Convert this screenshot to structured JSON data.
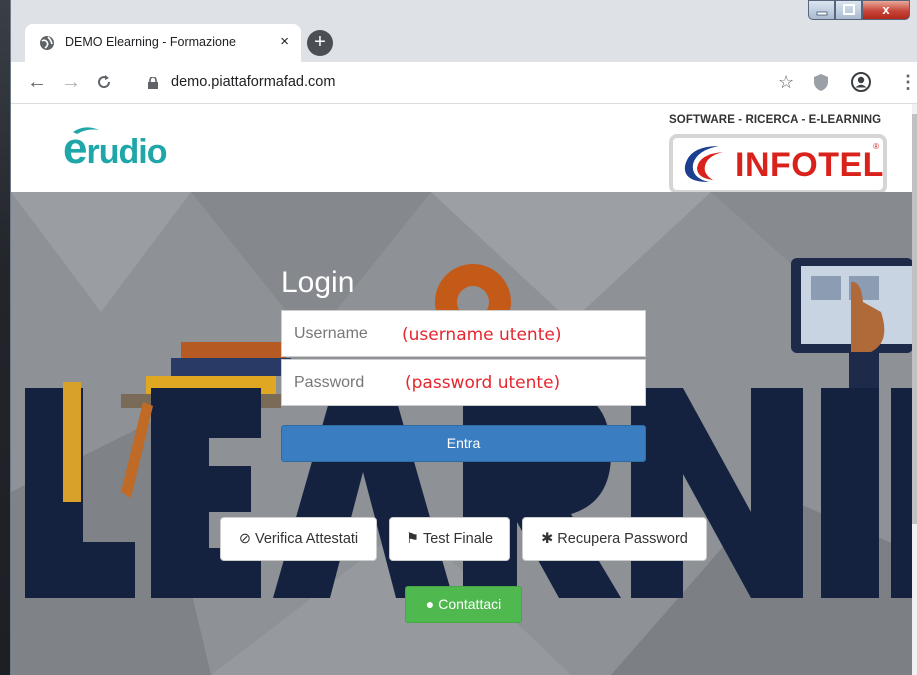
{
  "browser": {
    "tab_title": "DEMO Elearning - Formazione",
    "tab_close": "×",
    "new_tab": "+",
    "url": "demo.piattaformafad.com",
    "window_close": "x"
  },
  "header": {
    "logo_text": "rudio",
    "logo_initial": "e",
    "tagline": "SOFTWARE - RICERCA - E-LEARNING",
    "brand": "INFOTEL",
    "brand_reg": "®"
  },
  "hero": {
    "background_word": "LEARNIN"
  },
  "login": {
    "title": "Login",
    "username_placeholder": "Username",
    "password_placeholder": "Password",
    "username_note": "(username utente)",
    "password_note": "(password utente)",
    "submit_label": "Entra"
  },
  "actions": {
    "verify_label": "Verifica Attestati",
    "test_label": "Test Finale",
    "recover_label": "Recupera Password",
    "contact_label": "Contattaci"
  },
  "colors": {
    "primary": "#3a7ec1",
    "success": "#4fb84f",
    "note_red": "#e5262e",
    "brand_red": "#d9221b",
    "logo_teal": "#1fa6a8"
  }
}
